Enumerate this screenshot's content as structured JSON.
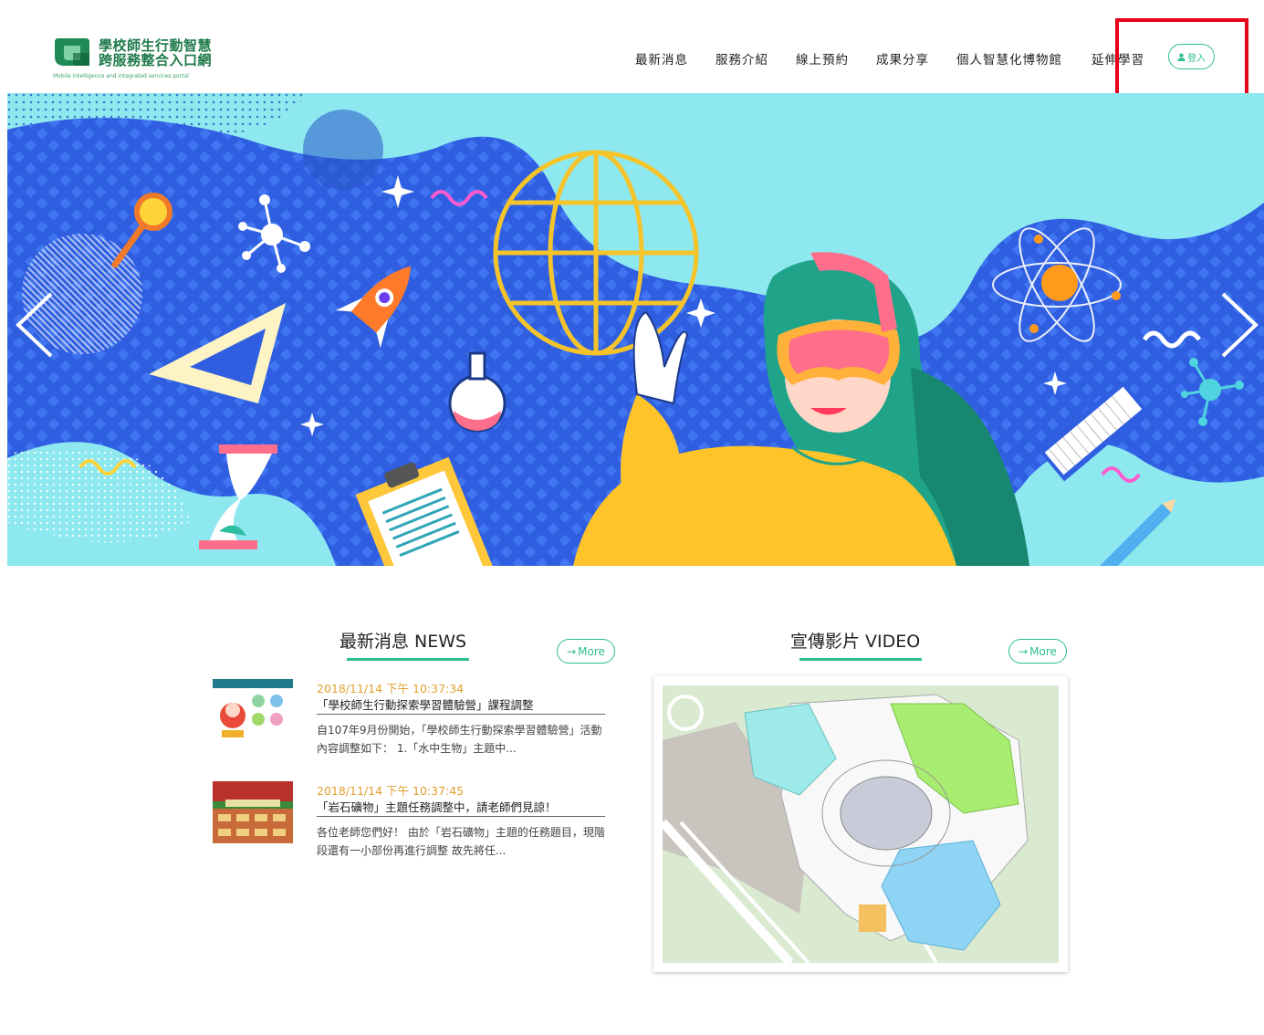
{
  "header": {
    "logo_title_line1": "學校師生行動智慧",
    "logo_title_line2": "跨服務整合入口網",
    "logo_subtitle": "Mobile intelligence and integrated services portal",
    "nav": [
      "最新消息",
      "服務介紹",
      "線上預約",
      "成果分享",
      "個人智慧化博物館",
      "延伸學習"
    ],
    "login_label": "登入",
    "login_icon": "user-icon"
  },
  "hero": {
    "prev_icon": "chevron-left-icon",
    "next_icon": "chevron-right-icon",
    "slide_count": 2,
    "active_slide": 1
  },
  "news": {
    "title": "最新消息 NEWS",
    "more_label": "More",
    "items": [
      {
        "date": "2018/11/14 下午 10:37:34",
        "title": "「學校師生行動探索學習體驗營」課程調整",
        "excerpt": "自107年9月份開始，「學校師生行動探索學習體驗營」活動內容調整如下： 1.「水中生物」主題中..."
      },
      {
        "date": "2018/11/14 下午 10:37:45",
        "title": "「岩石礦物」主題任務調整中，請老師們見諒！",
        "excerpt": "各位老師您們好！ 由於「岩石礦物」主題的任務題目，現階段還有一小部份再進行調整 故先將任..."
      }
    ]
  },
  "video": {
    "title": "宣傳影片 VIDEO",
    "more_label": "More"
  },
  "colors": {
    "accent": "#2dbf8a",
    "highlight": "#e6001a",
    "date": "#e0a030",
    "hero_blue": "#2f5fe0",
    "hero_cyan": "#8ee8ef"
  }
}
